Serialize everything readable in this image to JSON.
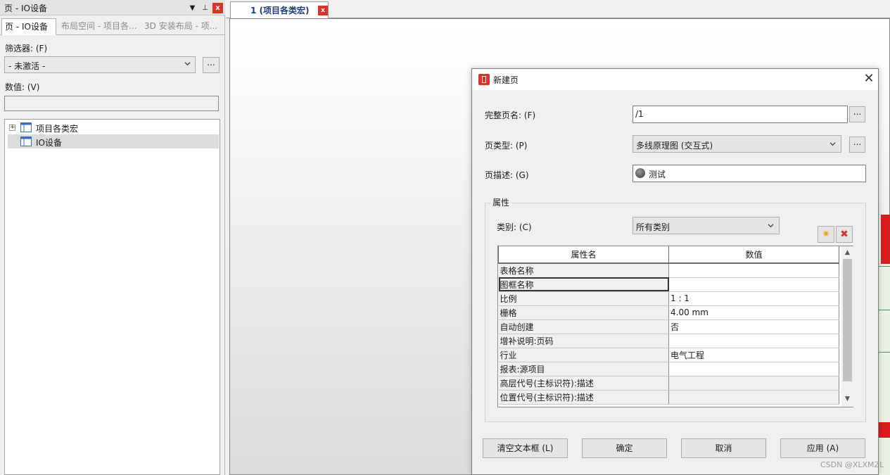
{
  "panel": {
    "title": "页 - IO设备",
    "pin_glyph": "▼",
    "pin2_glyph": "⊥",
    "close_glyph": "x",
    "tabs": [
      {
        "label": "页 - IO设备"
      },
      {
        "label": "布局空间 - 项目各..."
      },
      {
        "label": "3D 安装布局 - 项..."
      }
    ],
    "filter_label": "筛选器: (F)",
    "filter_value": "- 未激活 -",
    "filter_more": "...",
    "value_label": "数值: (V)",
    "value_text": "",
    "tree": [
      {
        "label": "项目各类宏",
        "expander": "+"
      },
      {
        "label": "IO设备"
      }
    ]
  },
  "document": {
    "tab_label": "1 (项目各类宏)",
    "tab_close": "x"
  },
  "dialog": {
    "title": "新建页",
    "close_glyph": "✕",
    "full_name_label": "完整页名: (F)",
    "full_name_value": "/1",
    "full_name_more": "...",
    "page_type_label": "页类型: (P)",
    "page_type_value": "多线原理图 (交互式)",
    "page_type_more": "...",
    "page_desc_label": "页描述: (G)",
    "page_desc_value": "测试",
    "properties_legend": "属性",
    "category_label": "类别: (C)",
    "category_value": "所有类别",
    "new_glyph": "✷",
    "delete_glyph": "✖",
    "grid_headers": [
      "属性名",
      "数值"
    ],
    "grid_rows": [
      {
        "name": "表格名称",
        "value": ""
      },
      {
        "name": "图框名称",
        "value": ""
      },
      {
        "name": "比例",
        "value": "1 : 1"
      },
      {
        "name": "栅格",
        "value": "4.00 mm"
      },
      {
        "name": "自动创建",
        "value": "否"
      },
      {
        "name": "增补说明:页码",
        "value": ""
      },
      {
        "name": "行业",
        "value": "电气工程"
      },
      {
        "name": "报表:源项目",
        "value": ""
      },
      {
        "name": "高层代号(主标识符):描述",
        "value": ""
      },
      {
        "name": "位置代号(主标识符):描述",
        "value": ""
      }
    ],
    "scroll_up": "▲",
    "scroll_down": "▼",
    "buttons": {
      "clear": "清空文本框 (L)",
      "ok": "确定",
      "cancel": "取消",
      "apply": "应用 (A)"
    }
  },
  "watermark": "CSDN @XLXMZL"
}
